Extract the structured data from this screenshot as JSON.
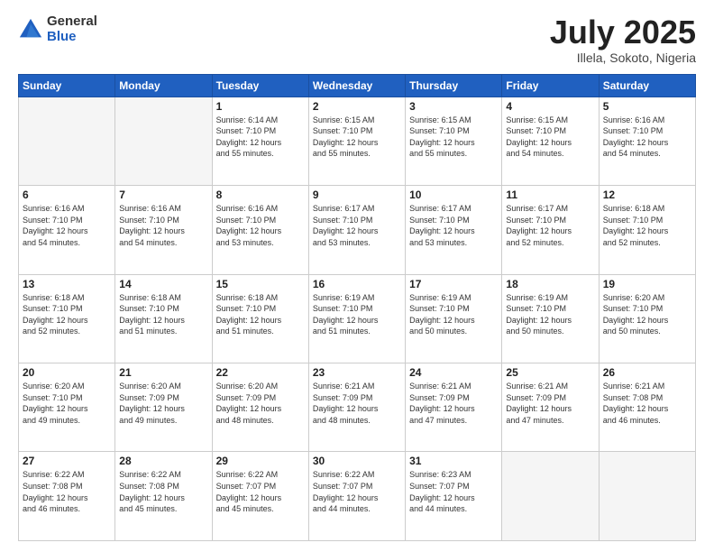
{
  "logo": {
    "general": "General",
    "blue": "Blue"
  },
  "header": {
    "month": "July 2025",
    "location": "Illela, Sokoto, Nigeria"
  },
  "days_of_week": [
    "Sunday",
    "Monday",
    "Tuesday",
    "Wednesday",
    "Thursday",
    "Friday",
    "Saturday"
  ],
  "weeks": [
    [
      {
        "day": "",
        "info": ""
      },
      {
        "day": "",
        "info": ""
      },
      {
        "day": "1",
        "info": "Sunrise: 6:14 AM\nSunset: 7:10 PM\nDaylight: 12 hours\nand 55 minutes."
      },
      {
        "day": "2",
        "info": "Sunrise: 6:15 AM\nSunset: 7:10 PM\nDaylight: 12 hours\nand 55 minutes."
      },
      {
        "day": "3",
        "info": "Sunrise: 6:15 AM\nSunset: 7:10 PM\nDaylight: 12 hours\nand 55 minutes."
      },
      {
        "day": "4",
        "info": "Sunrise: 6:15 AM\nSunset: 7:10 PM\nDaylight: 12 hours\nand 54 minutes."
      },
      {
        "day": "5",
        "info": "Sunrise: 6:16 AM\nSunset: 7:10 PM\nDaylight: 12 hours\nand 54 minutes."
      }
    ],
    [
      {
        "day": "6",
        "info": "Sunrise: 6:16 AM\nSunset: 7:10 PM\nDaylight: 12 hours\nand 54 minutes."
      },
      {
        "day": "7",
        "info": "Sunrise: 6:16 AM\nSunset: 7:10 PM\nDaylight: 12 hours\nand 54 minutes."
      },
      {
        "day": "8",
        "info": "Sunrise: 6:16 AM\nSunset: 7:10 PM\nDaylight: 12 hours\nand 53 minutes."
      },
      {
        "day": "9",
        "info": "Sunrise: 6:17 AM\nSunset: 7:10 PM\nDaylight: 12 hours\nand 53 minutes."
      },
      {
        "day": "10",
        "info": "Sunrise: 6:17 AM\nSunset: 7:10 PM\nDaylight: 12 hours\nand 53 minutes."
      },
      {
        "day": "11",
        "info": "Sunrise: 6:17 AM\nSunset: 7:10 PM\nDaylight: 12 hours\nand 52 minutes."
      },
      {
        "day": "12",
        "info": "Sunrise: 6:18 AM\nSunset: 7:10 PM\nDaylight: 12 hours\nand 52 minutes."
      }
    ],
    [
      {
        "day": "13",
        "info": "Sunrise: 6:18 AM\nSunset: 7:10 PM\nDaylight: 12 hours\nand 52 minutes."
      },
      {
        "day": "14",
        "info": "Sunrise: 6:18 AM\nSunset: 7:10 PM\nDaylight: 12 hours\nand 51 minutes."
      },
      {
        "day": "15",
        "info": "Sunrise: 6:18 AM\nSunset: 7:10 PM\nDaylight: 12 hours\nand 51 minutes."
      },
      {
        "day": "16",
        "info": "Sunrise: 6:19 AM\nSunset: 7:10 PM\nDaylight: 12 hours\nand 51 minutes."
      },
      {
        "day": "17",
        "info": "Sunrise: 6:19 AM\nSunset: 7:10 PM\nDaylight: 12 hours\nand 50 minutes."
      },
      {
        "day": "18",
        "info": "Sunrise: 6:19 AM\nSunset: 7:10 PM\nDaylight: 12 hours\nand 50 minutes."
      },
      {
        "day": "19",
        "info": "Sunrise: 6:20 AM\nSunset: 7:10 PM\nDaylight: 12 hours\nand 50 minutes."
      }
    ],
    [
      {
        "day": "20",
        "info": "Sunrise: 6:20 AM\nSunset: 7:10 PM\nDaylight: 12 hours\nand 49 minutes."
      },
      {
        "day": "21",
        "info": "Sunrise: 6:20 AM\nSunset: 7:09 PM\nDaylight: 12 hours\nand 49 minutes."
      },
      {
        "day": "22",
        "info": "Sunrise: 6:20 AM\nSunset: 7:09 PM\nDaylight: 12 hours\nand 48 minutes."
      },
      {
        "day": "23",
        "info": "Sunrise: 6:21 AM\nSunset: 7:09 PM\nDaylight: 12 hours\nand 48 minutes."
      },
      {
        "day": "24",
        "info": "Sunrise: 6:21 AM\nSunset: 7:09 PM\nDaylight: 12 hours\nand 47 minutes."
      },
      {
        "day": "25",
        "info": "Sunrise: 6:21 AM\nSunset: 7:09 PM\nDaylight: 12 hours\nand 47 minutes."
      },
      {
        "day": "26",
        "info": "Sunrise: 6:21 AM\nSunset: 7:08 PM\nDaylight: 12 hours\nand 46 minutes."
      }
    ],
    [
      {
        "day": "27",
        "info": "Sunrise: 6:22 AM\nSunset: 7:08 PM\nDaylight: 12 hours\nand 46 minutes."
      },
      {
        "day": "28",
        "info": "Sunrise: 6:22 AM\nSunset: 7:08 PM\nDaylight: 12 hours\nand 45 minutes."
      },
      {
        "day": "29",
        "info": "Sunrise: 6:22 AM\nSunset: 7:07 PM\nDaylight: 12 hours\nand 45 minutes."
      },
      {
        "day": "30",
        "info": "Sunrise: 6:22 AM\nSunset: 7:07 PM\nDaylight: 12 hours\nand 44 minutes."
      },
      {
        "day": "31",
        "info": "Sunrise: 6:23 AM\nSunset: 7:07 PM\nDaylight: 12 hours\nand 44 minutes."
      },
      {
        "day": "",
        "info": ""
      },
      {
        "day": "",
        "info": ""
      }
    ]
  ]
}
